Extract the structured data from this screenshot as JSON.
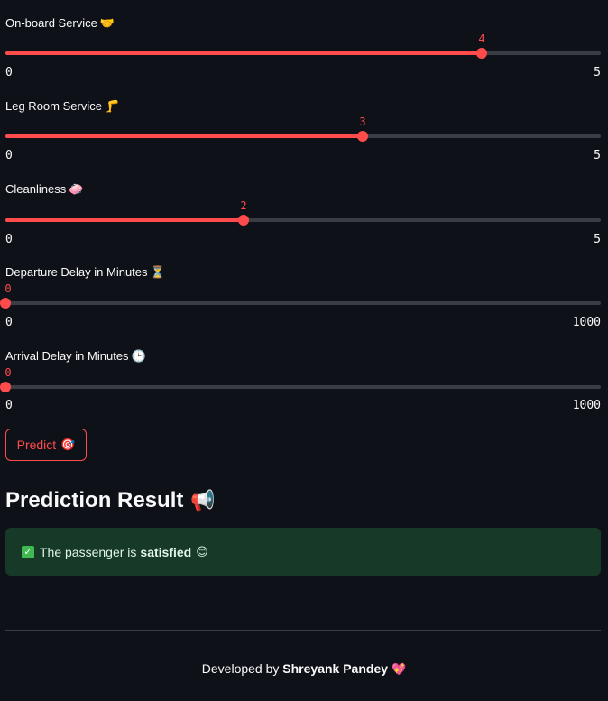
{
  "sliders": [
    {
      "label": "On-board Service",
      "emoji": "🤝",
      "icon": "handshake-icon",
      "value": 4,
      "min": 0,
      "max": 5,
      "value_text": "4",
      "min_text": "0",
      "max_text": "5"
    },
    {
      "label": "Leg Room Service",
      "emoji": "🦵",
      "icon": "leg-icon",
      "value": 3,
      "min": 0,
      "max": 5,
      "value_text": "3",
      "min_text": "0",
      "max_text": "5"
    },
    {
      "label": "Cleanliness",
      "emoji": "🧼",
      "icon": "soap-icon",
      "value": 2,
      "min": 0,
      "max": 5,
      "value_text": "2",
      "min_text": "0",
      "max_text": "5"
    },
    {
      "label": "Departure Delay in Minutes",
      "emoji": "⏳",
      "icon": "hourglass-icon",
      "value": 0,
      "min": 0,
      "max": 1000,
      "value_text": "0",
      "min_text": "0",
      "max_text": "1000"
    },
    {
      "label": "Arrival Delay in Minutes",
      "emoji": "🕒",
      "icon": "clock-icon",
      "value": 0,
      "min": 0,
      "max": 1000,
      "value_text": "0",
      "min_text": "0",
      "max_text": "1000"
    }
  ],
  "predict_button": {
    "label": "Predict",
    "emoji": "🎯",
    "icon": "target-icon"
  },
  "result": {
    "heading": "Prediction Result",
    "heading_emoji": "📢",
    "heading_icon": "megaphone-icon",
    "check_glyph": "✓",
    "check_icon": "check-box-icon",
    "message_prefix": "The passenger is",
    "message_bold": "satisfied",
    "message_emoji": "😊",
    "message_icon": "smile-icon"
  },
  "footer": {
    "prefix": "Developed by",
    "author": "Shreyank Pandey",
    "emoji": "💖",
    "icon": "heart-icon"
  },
  "colors": {
    "accent": "#ff4b4b",
    "background": "#0e1117",
    "track": "#3a3d44",
    "success_bg": "#173928"
  }
}
